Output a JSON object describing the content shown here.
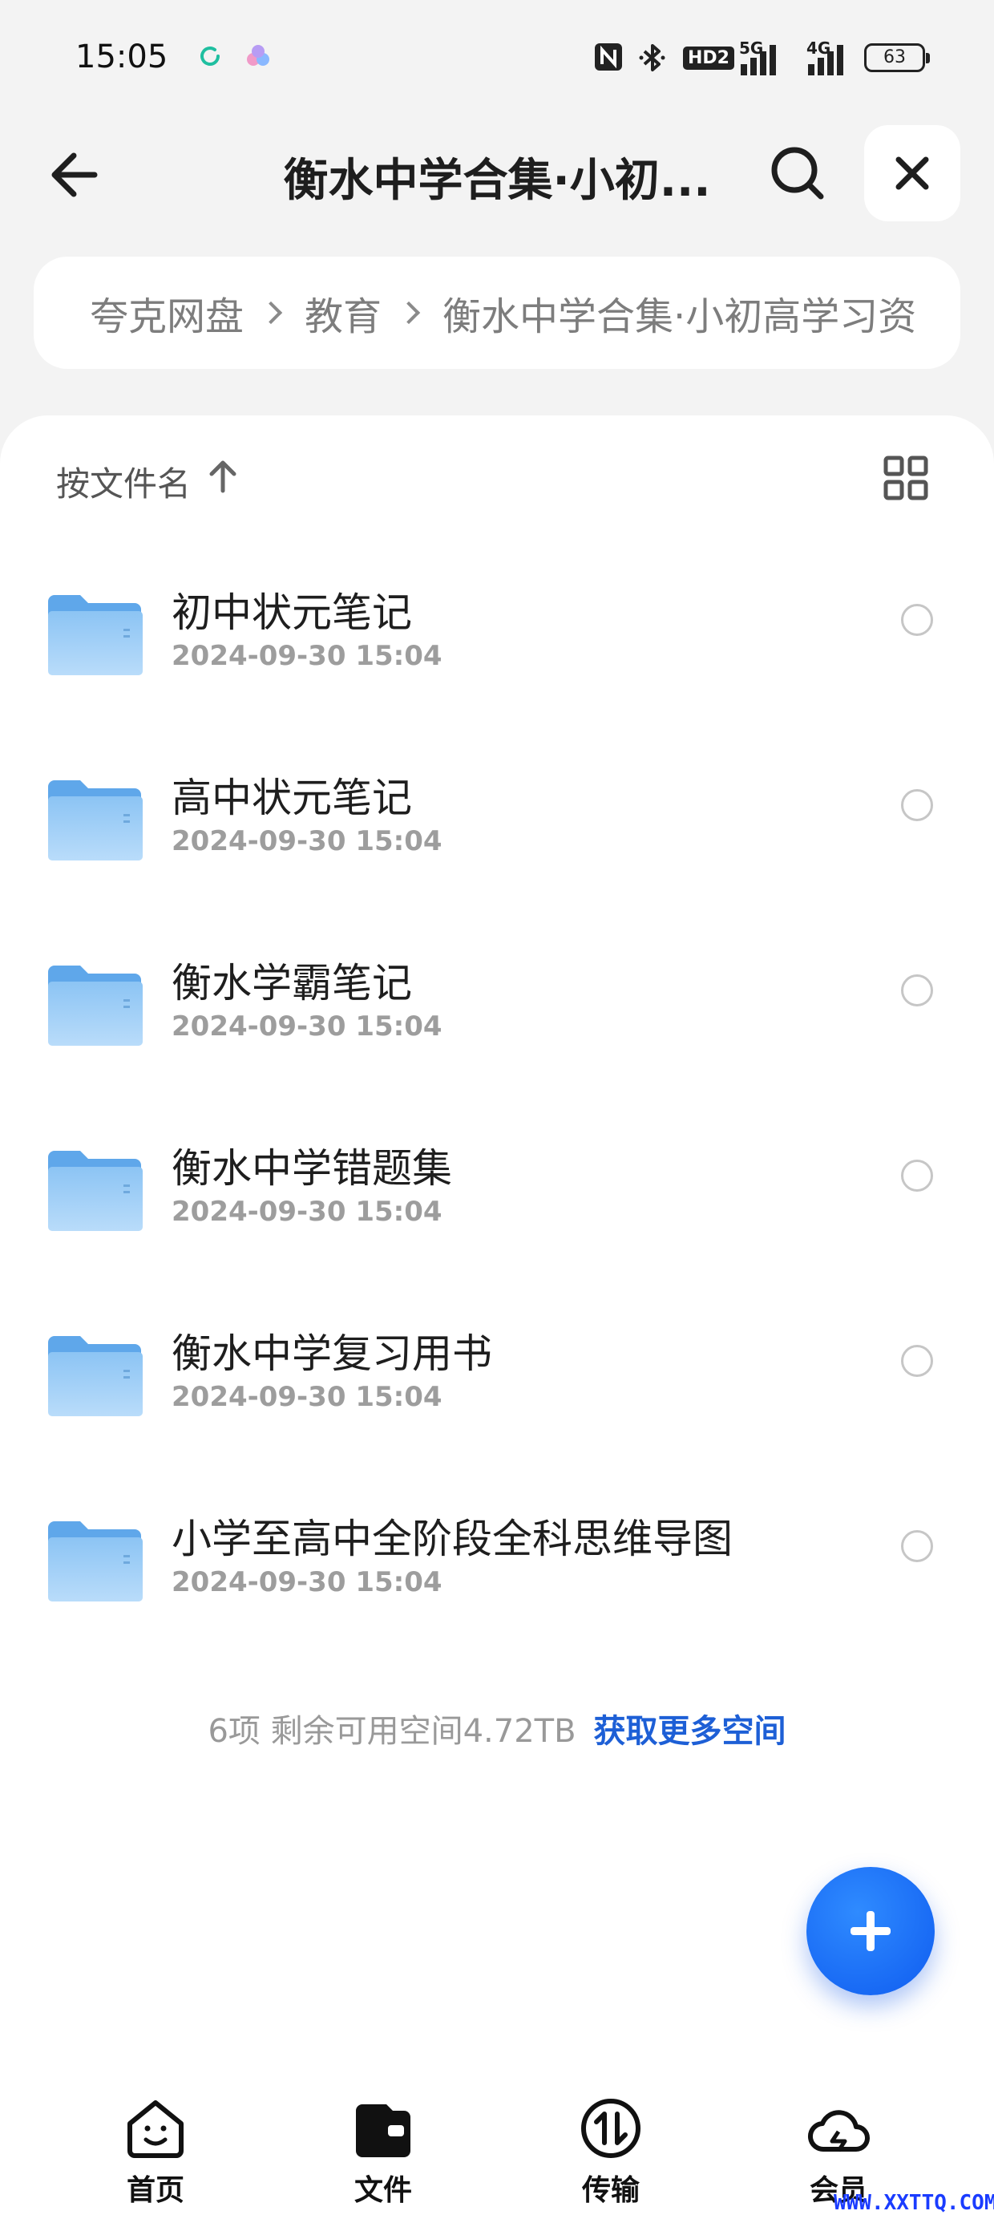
{
  "status_bar": {
    "time": "15:05",
    "network_badge": "HD2",
    "signal_1": "5G",
    "signal_2": "4G",
    "battery": "63"
  },
  "header": {
    "title": "衡水中学合集·小初...",
    "back_icon": "arrow-left-icon",
    "search_icon": "search-icon",
    "close_icon": "close-icon"
  },
  "breadcrumb": [
    "夸克网盘",
    "教育",
    "衡水中学合集·小初高学习资"
  ],
  "toolbar": {
    "sort_label": "按文件名",
    "sort_icon": "arrow-up-icon",
    "view_icon": "grid-icon"
  },
  "files": [
    {
      "name": "初中状元笔记",
      "date": "2024-09-30 15:04"
    },
    {
      "name": "高中状元笔记",
      "date": "2024-09-30 15:04"
    },
    {
      "name": "衡水学霸笔记",
      "date": "2024-09-30 15:04"
    },
    {
      "name": "衡水中学错题集",
      "date": "2024-09-30 15:04"
    },
    {
      "name": "衡水中学复习用书",
      "date": "2024-09-30 15:04"
    },
    {
      "name": "小学至高中全阶段全科思维导图",
      "date": "2024-09-30 15:04"
    }
  ],
  "footer": {
    "count_text": "6项 剩余可用空间4.72TB",
    "get_more_label": "获取更多空间"
  },
  "fab_icon": "plus-icon",
  "bottom_nav": [
    {
      "label": "首页",
      "icon": "home-smile-icon",
      "active": false
    },
    {
      "label": "文件",
      "icon": "wallet-folder-icon",
      "active": true
    },
    {
      "label": "传输",
      "icon": "transfer-icon",
      "active": false
    },
    {
      "label": "会员",
      "icon": "cloud-icon",
      "active": false
    }
  ],
  "watermark": "WWW.XXTTQ.COM",
  "colors": {
    "accent": "#1d5fd6",
    "fab": "#1a6cf5",
    "folder": "#7ab8f0",
    "background": "#f3f3f3"
  }
}
